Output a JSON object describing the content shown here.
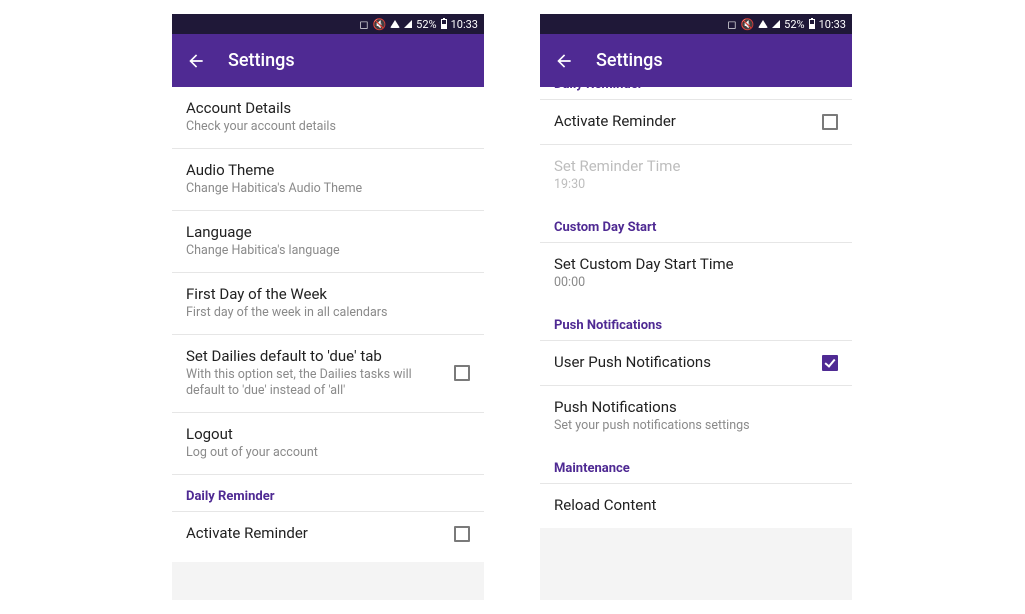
{
  "status": {
    "battery_text": "52%",
    "time": "10:33"
  },
  "appbar": {
    "title": "Settings"
  },
  "left": {
    "items": {
      "account": {
        "title": "Account Details",
        "subtitle": "Check your account details"
      },
      "audio": {
        "title": "Audio Theme",
        "subtitle": "Change Habitica's Audio Theme"
      },
      "language": {
        "title": "Language",
        "subtitle": "Change Habitica's language"
      },
      "firstday": {
        "title": "First Day of the Week",
        "subtitle": "First day of the week in all calendars"
      },
      "dailies": {
        "title": "Set Dailies default to 'due' tab",
        "subtitle": "With this option set, the Dailies tasks will default to 'due' instead of 'all'"
      },
      "logout": {
        "title": "Logout",
        "subtitle": "Log out of your account"
      }
    },
    "section_daily_reminder": "Daily Reminder",
    "activate_reminder": {
      "title": "Activate Reminder"
    }
  },
  "right": {
    "cut_header": "Daily Reminder",
    "activate_reminder": {
      "title": "Activate Reminder"
    },
    "reminder_time": {
      "title": "Set Reminder Time",
      "subtitle": "19:30"
    },
    "section_custom_day": "Custom Day Start",
    "custom_day": {
      "title": "Set Custom Day Start Time",
      "subtitle": "00:00"
    },
    "section_push": "Push Notifications",
    "user_push": {
      "title": "User Push Notifications"
    },
    "push_settings": {
      "title": "Push Notifications",
      "subtitle": "Set your push notifications settings"
    },
    "section_maintenance": "Maintenance",
    "reload": {
      "title": "Reload Content"
    }
  }
}
